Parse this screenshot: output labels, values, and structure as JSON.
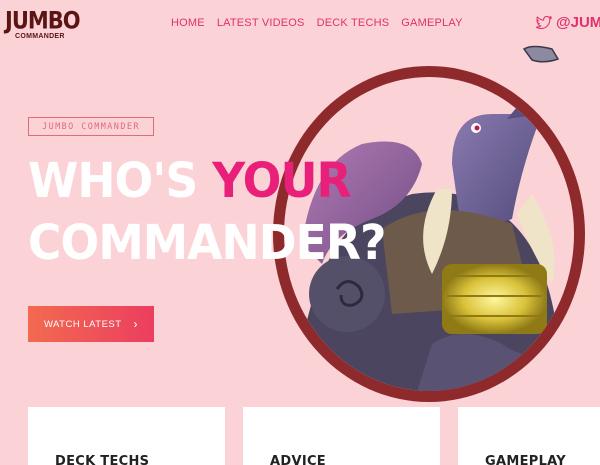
{
  "brand": {
    "logo_main": "JUMBO",
    "logo_sub": "COMMANDER"
  },
  "nav": {
    "items": [
      {
        "label": "HOME"
      },
      {
        "label": "LATEST VIDEOS"
      },
      {
        "label": "DECK TECHS"
      },
      {
        "label": "GAMEPLAY"
      }
    ]
  },
  "social": {
    "icon": "twitter-icon",
    "handle": "@JUMB"
  },
  "hero": {
    "pill": "JUMBO COMMANDER",
    "headline_line1_white": "WHO'S ",
    "headline_line1_accent": "YOUR",
    "headline_line2": "COMMANDER?",
    "cta_label": "WATCH LATEST",
    "cta_icon": "chevron-right-icon"
  },
  "cards": [
    {
      "title": "DECK TECHS"
    },
    {
      "title": "ADVICE"
    },
    {
      "title": "GAMEPLAY"
    }
  ],
  "colors": {
    "background": "#fbd3d6",
    "accent": "#e8207a",
    "brand_dark": "#5b1414",
    "frame": "#8f2a2c"
  }
}
